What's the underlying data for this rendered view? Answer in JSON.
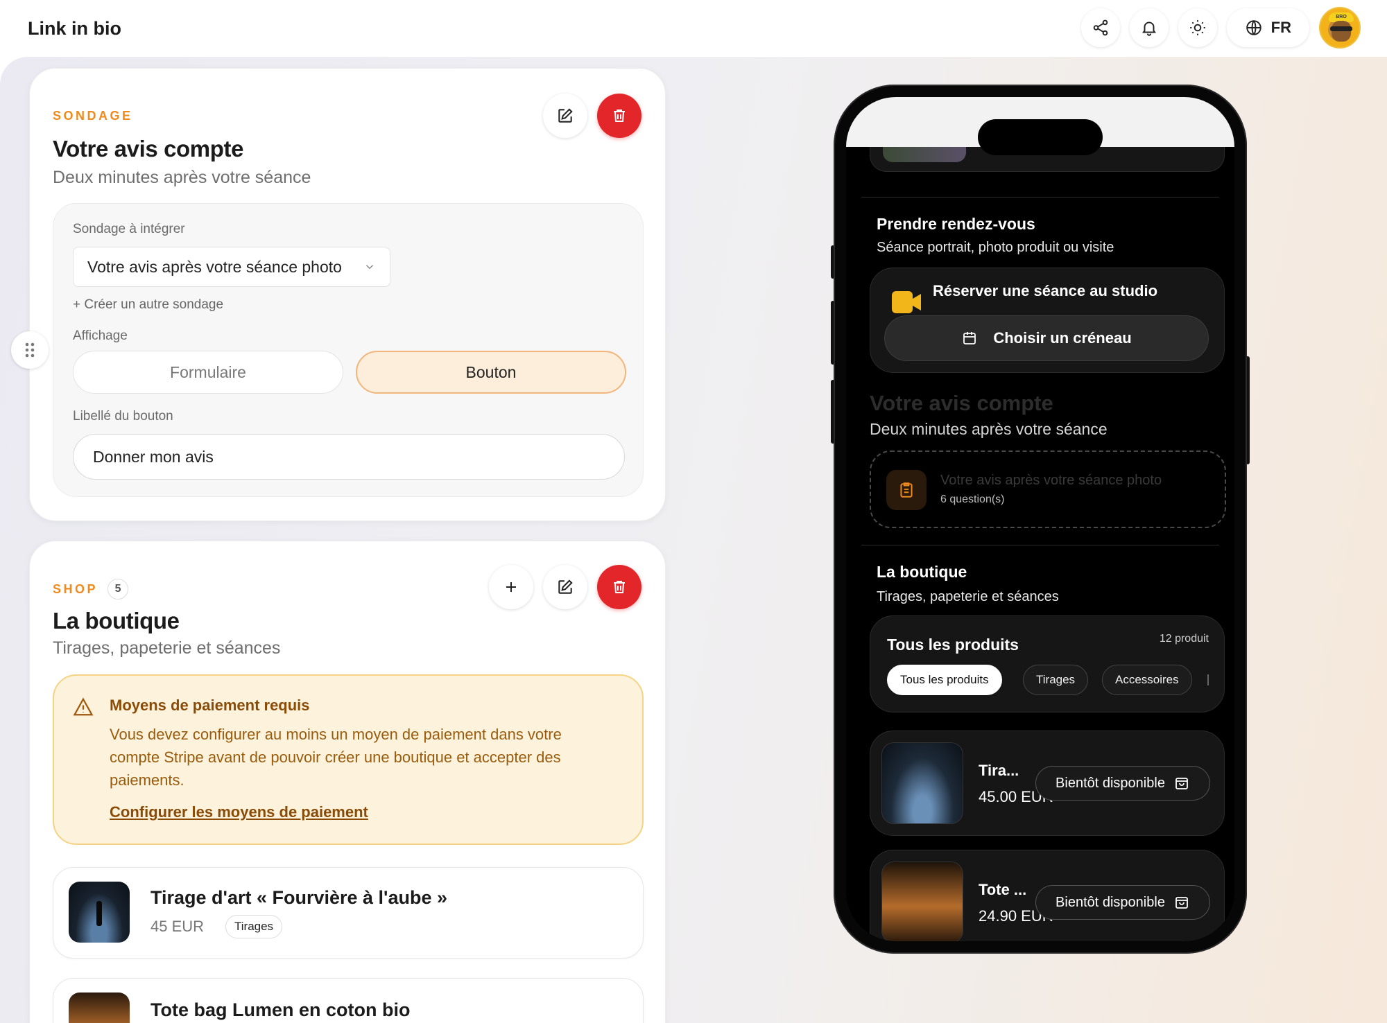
{
  "app": {
    "title": "Link in bio"
  },
  "topbar": {
    "lang": "FR",
    "avatar_text": "BRO"
  },
  "poll_card": {
    "eyebrow": "SONDAGE",
    "title": "Votre avis compte",
    "subtitle": "Deux minutes après votre séance",
    "poll_label": "Sondage à intégrer",
    "poll_selected": "Votre avis après votre séance photo",
    "create_link": "+ Créer un autre sondage",
    "display_label": "Affichage",
    "display_options": [
      "Formulaire",
      "Bouton"
    ],
    "display_selected": "Bouton",
    "button_label_label": "Libellé du bouton",
    "button_label_value": "Donner mon avis"
  },
  "shop_card": {
    "eyebrow": "SHOP",
    "count": "5",
    "title": "La boutique",
    "subtitle": "Tirages, papeterie et séances",
    "warning": {
      "title": "Moyens de paiement requis",
      "body": "Vous devez configurer au moins un moyen de paiement dans votre compte Stripe avant de pouvoir créer une boutique et accepter des paiements.",
      "link": "Configurer les moyens de paiement"
    },
    "products": [
      {
        "name": "Tirage d'art « Fourvière à l'aube »",
        "price": "45 EUR",
        "tag": "Tirages"
      },
      {
        "name": "Tote bag Lumen en coton bio"
      }
    ]
  },
  "phone": {
    "booking": {
      "title": "Prendre rendez-vous",
      "subtitle": "Séance portrait, photo produit ou visite",
      "card_title": "Réserver une séance au studio",
      "button": "Choisir un créneau"
    },
    "poll": {
      "title": "Votre avis compte",
      "subtitle": "Deux minutes après votre séance",
      "poll_name": "Votre avis après votre séance photo",
      "questions": "6 question(s)"
    },
    "shop": {
      "title": "La boutique",
      "subtitle": "Tirages, papeterie et séances",
      "filter_title": "Tous les produits",
      "product_count": "12 produit",
      "chips": [
        "Tous les produits",
        "Tirages",
        "Accessoires"
      ],
      "items": [
        {
          "name": "Tira...",
          "price": "45.00 EUR",
          "status": "Bientôt disponible"
        },
        {
          "name": "Tote ...",
          "price": "24.90 EUR",
          "status": "Bientôt disponible"
        }
      ]
    }
  },
  "colors": {
    "accent": "#f08a1c",
    "danger": "#e3262a",
    "warning_bg": "#fdf3dc",
    "phone_bg": "#000000"
  }
}
